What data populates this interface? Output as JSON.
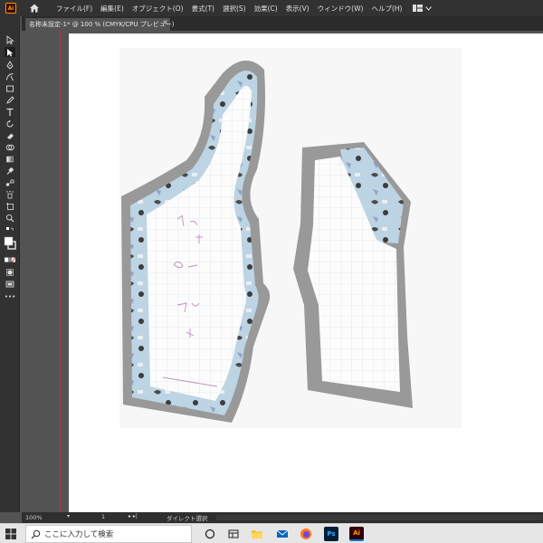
{
  "app": {
    "logo": "Ai",
    "brand_color": "#ff9a00",
    "menus": [
      "ファイル(F)",
      "編集(E)",
      "オブジェクト(O)",
      "書式(T)",
      "選択(S)",
      "効果(C)",
      "表示(V)",
      "ウィンドウ(W)",
      "ヘルプ(H)"
    ]
  },
  "document": {
    "tab_title": "名称未設定-1* @ 100 % (CMYK/CPU プレビュー)",
    "close_label": "×"
  },
  "toolbar": {
    "tools": [
      "selection-tool",
      "direct-selection-tool",
      "pen-tool",
      "curvature-tool",
      "rectangle-tool",
      "pencil-tool",
      "type-tool",
      "rotate-tool",
      "eraser-tool",
      "shape-builder-tool",
      "gradient-tool",
      "eyedropper-tool",
      "blend-tool",
      "symbol-sprayer-tool",
      "artboard-tool",
      "zoom-tool"
    ],
    "more_label": "•••"
  },
  "status": {
    "zoom": "100%",
    "page": "1",
    "tool_name": "ダイレクト選択"
  },
  "taskbar": {
    "search_placeholder": "ここに入力して検索",
    "apps": [
      "task-view",
      "widgets",
      "file-explorer",
      "mail",
      "firefox",
      "photoshop",
      "illustrator"
    ],
    "ps_label": "Ps",
    "ai_label": "Ai"
  }
}
